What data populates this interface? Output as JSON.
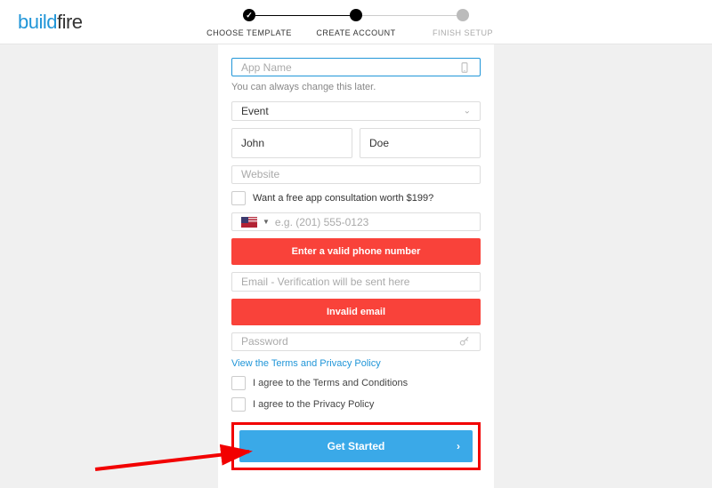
{
  "logo": {
    "part1": "build",
    "part2": "fire"
  },
  "stepper": {
    "steps": [
      {
        "label": "CHOOSE TEMPLATE",
        "state": "done"
      },
      {
        "label": "CREATE ACCOUNT",
        "state": "active"
      },
      {
        "label": "FINISH SETUP",
        "state": "inactive"
      }
    ]
  },
  "form": {
    "app_name_placeholder": "App Name",
    "app_name_hint": "You can always change this later.",
    "category_value": "Event",
    "first_name_value": "John",
    "last_name_value": "Doe",
    "website_placeholder": "Website",
    "consultation_label": "Want a free app consultation worth $199?",
    "phone_placeholder": "e.g. (201) 555-0123",
    "phone_error": "Enter a valid phone number",
    "email_placeholder": "Email - Verification will be sent here",
    "email_error": "Invalid email",
    "password_placeholder": "Password",
    "terms_link": "View the Terms and Privacy Policy",
    "agree_terms": "I agree to the Terms and Conditions",
    "agree_privacy": "I agree to the Privacy Policy",
    "cta_label": "Get Started"
  }
}
